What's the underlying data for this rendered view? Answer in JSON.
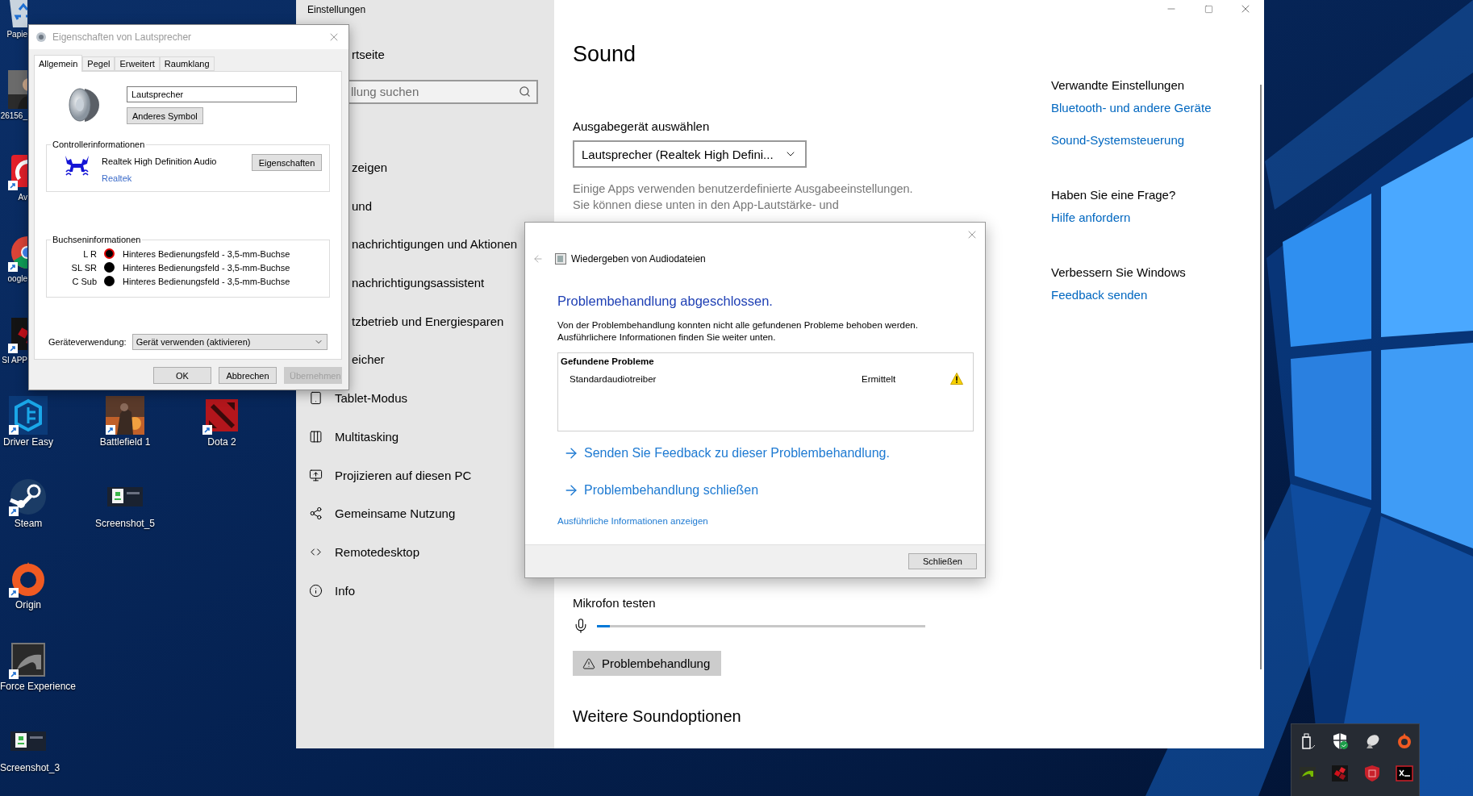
{
  "desktop": {
    "icons": [
      {
        "label": "Papie",
        "kind": "bin",
        "shortcut": false
      },
      {
        "label": "26156_",
        "shortcut": false
      },
      {
        "label": "Av",
        "kind": "red-app",
        "shortcut": true
      },
      {
        "label": "oogle",
        "kind": "tricolor",
        "shortcut": true
      },
      {
        "label": "SI APP",
        "kind": "red-squares",
        "shortcut": true
      },
      {
        "label": "Driver Easy",
        "kind": "hexagon",
        "shortcut": true
      },
      {
        "label": "Battlefield 1",
        "kind": "game-art",
        "shortcut": true
      },
      {
        "label": "Dota 2",
        "kind": "red-emblem",
        "shortcut": true
      },
      {
        "label": "Steam",
        "kind": "piston",
        "shortcut": true
      },
      {
        "label": "Screenshot_5",
        "kind": "screenshot",
        "shortcut": false
      },
      {
        "label": "Origin",
        "kind": "orange-ring",
        "shortcut": true
      },
      {
        "label": "Force Experience",
        "kind": "claw",
        "shortcut": true
      },
      {
        "label": "Screenshot_3",
        "kind": "screenshot",
        "shortcut": false
      }
    ]
  },
  "settings": {
    "title": "Einstellungen",
    "home": "rtseite",
    "search": {
      "placeholder": "llung suchen"
    },
    "nav": [
      {
        "label": "zeigen",
        "kind": "cut"
      },
      {
        "label": "und",
        "kind": "cut"
      },
      {
        "label": "nachrichtigungen und Aktionen",
        "kind": "cut"
      },
      {
        "label": "nachrichtigungsassistent",
        "kind": "cut"
      },
      {
        "label": "tzbetrieb und Energiesparen",
        "kind": "cut"
      },
      {
        "label": "eicher",
        "kind": "cut"
      },
      {
        "label": "Tablet-Modus",
        "kind": "tablet"
      },
      {
        "label": "Multitasking",
        "kind": "multitasking"
      },
      {
        "label": "Projizieren auf diesen PC",
        "kind": "projecting"
      },
      {
        "label": "Gemeinsame Nutzung",
        "kind": "sharing"
      },
      {
        "label": "Remotedesktop",
        "kind": "remote"
      },
      {
        "label": "Info",
        "kind": "info"
      }
    ],
    "page": {
      "title": "Sound",
      "output_label": "Ausgabegerät auswählen",
      "output_device": "Lautsprecher (Realtek High Defini...",
      "description_lines": [
        "Einige Apps verwenden benutzerdefinierte Ausgabeeinstellungen.",
        "Sie können diese unten in den App-Lautstärke- und"
      ],
      "mic_label": "Mikrofon testen",
      "mic": {
        "level": 0.04
      },
      "troubleshoot_button": "Problembehandlung",
      "more_heading": "Weitere Soundoptionen"
    },
    "sections": [
      {
        "heading": "Verwandte Einstellungen",
        "links": [
          "Bluetooth- und andere Geräte",
          "Sound-Systemsteuerung"
        ]
      },
      {
        "heading": "Haben Sie eine Frage?",
        "links": [
          "Hilfe anfordern"
        ]
      },
      {
        "heading": "Verbessern Sie Windows",
        "links": [
          "Feedback senden"
        ]
      }
    ]
  },
  "properties_dialog": {
    "title": "Eigenschaften von Lautsprecher",
    "tabs": [
      {
        "label": "Allgemein",
        "selected": true
      },
      {
        "label": "Pegel",
        "selected": false
      },
      {
        "label": "Erweitert",
        "selected": false
      },
      {
        "label": "Raumklang",
        "selected": false
      }
    ],
    "name": "Lautsprecher",
    "change_icon_button": "Anderes Symbol",
    "controller": {
      "heading": "Controllerinformationen",
      "name": "Realtek High Definition Audio",
      "link": "Realtek",
      "button": "Eigenschaften"
    },
    "jacks": {
      "heading": "Buchseninformationen",
      "rows": [
        {
          "channel": "L R",
          "color": "#e00000",
          "location": "Hinteres Bedienungsfeld - 3,5-mm-Buchse"
        },
        {
          "channel": "SL SR",
          "color": "#000000",
          "location": "Hinteres Bedienungsfeld - 3,5-mm-Buchse"
        },
        {
          "channel": "C Sub",
          "color": "#000000",
          "location": "Hinteres Bedienungsfeld - 3,5-mm-Buchse"
        }
      ]
    },
    "usage": {
      "label": "Geräteverwendung:",
      "value": "Gerät verwenden (aktivieren)"
    },
    "buttons": [
      {
        "label": "OK",
        "disabled": false
      },
      {
        "label": "Abbrechen",
        "disabled": false
      },
      {
        "label": "Übernehmen",
        "disabled": true
      }
    ]
  },
  "troubleshooter": {
    "title": "Wiedergeben von Audiodateien",
    "heading": "Problembehandlung abgeschlossen.",
    "message_lines": [
      "Von der Problembehandlung konnten nicht alle gefundenen Probleme behoben werden.",
      "Ausführlichere Informationen finden Sie weiter unten."
    ],
    "problems": {
      "heading": "Gefundene Probleme",
      "rows": [
        {
          "name": "Standardaudiotreiber",
          "status": "Ermittelt"
        }
      ]
    },
    "links": [
      "Senden Sie Feedback zu dieser Problembehandlung.",
      "Problembehandlung schließen"
    ],
    "details_link": "Ausführliche Informationen anzeigen",
    "close_button": "Schließen"
  },
  "tray": {
    "icons": [
      {
        "kind": "usb"
      },
      {
        "kind": "shield"
      },
      {
        "kind": "dish"
      },
      {
        "kind": "orange-ring"
      },
      {
        "kind": "green-claw"
      },
      {
        "kind": "red-squares"
      },
      {
        "kind": "red-shield"
      },
      {
        "kind": "terminal"
      }
    ]
  }
}
